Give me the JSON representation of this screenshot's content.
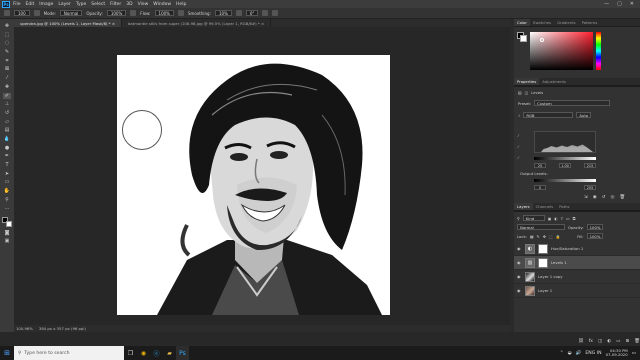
{
  "menu": {
    "logo": "Ps",
    "items": [
      "File",
      "Edit",
      "Image",
      "Layer",
      "Type",
      "Select",
      "Filter",
      "3D",
      "View",
      "Window",
      "Help"
    ],
    "window_controls": [
      "—",
      "▢",
      "✕"
    ]
  },
  "options_bar": {
    "size": "100",
    "mode_label": "Mode:",
    "mode": "Normal",
    "opacity_label": "Opacity:",
    "opacity": "100%",
    "flow_label": "Flow:",
    "flow": "100%",
    "smoothing_label": "Smoothing:",
    "smoothing": "10%",
    "angle": "0°"
  },
  "tabs": [
    {
      "label": "upendra.jpg @ 100% (Levels 1, Layer Mask/8) *",
      "active": true
    },
    {
      "label": "batmantie stills from super (108-98.jpg @ 99.5% (Layer 1, RGB/8#) *",
      "active": false
    }
  ],
  "status": {
    "zoom": "100.96%",
    "doc_info": "384 px x 357 px (96 ppi)"
  },
  "color_panel": {
    "tabs": [
      "Color",
      "Swatches",
      "Gradients",
      "Patterns"
    ]
  },
  "properties_panel": {
    "tabs": [
      "Properties",
      "Adjustments"
    ],
    "adjustment_name": "Levels",
    "preset_label": "Preset:",
    "preset": "Custom",
    "channel": "RGB",
    "auto_label": "Auto",
    "input_levels": [
      "25",
      "1.00",
      "215"
    ],
    "output_label": "Output Levels:",
    "output_levels": [
      "0",
      "255"
    ]
  },
  "layers_panel": {
    "tabs": [
      "Layers",
      "Channels",
      "Paths"
    ],
    "kind_label": "Kind",
    "blend_mode": "Normal",
    "opacity_label": "Opacity:",
    "opacity": "100%",
    "lock_label": "Lock:",
    "fill_label": "Fill:",
    "fill": "100%",
    "layers": [
      {
        "name": "Hue/Saturation 1",
        "thumb": "adj",
        "selected": false
      },
      {
        "name": "Levels 1",
        "thumb": "adj",
        "selected": true
      },
      {
        "name": "Layer 1 copy",
        "thumb": "bw",
        "selected": false
      },
      {
        "name": "Layer 1",
        "thumb": "photo",
        "selected": false
      }
    ]
  },
  "taskbar": {
    "search_placeholder": "Type here to search",
    "language": "ENG",
    "region": "IN",
    "time": "04:30 PM",
    "date": "07-09-2020"
  }
}
